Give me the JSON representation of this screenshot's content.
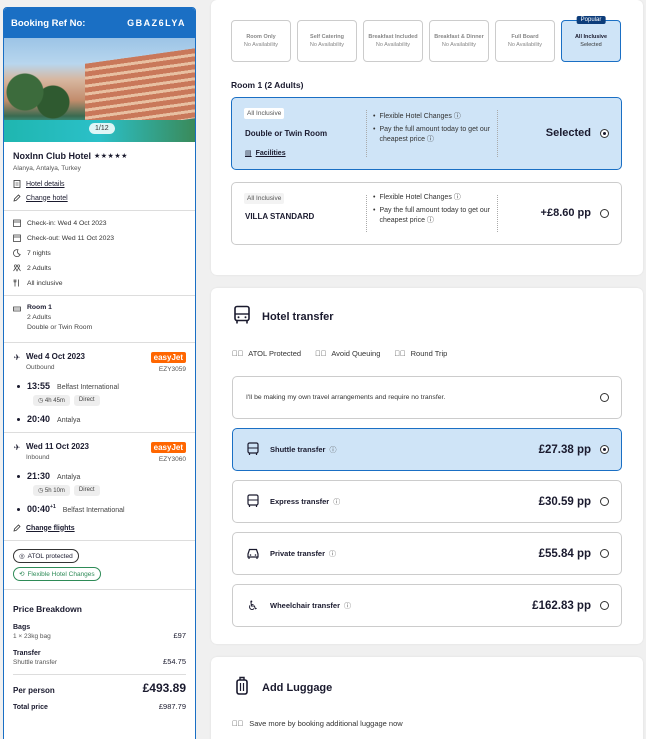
{
  "sidebar": {
    "ref_label": "Booking Ref No:",
    "ref_code": "GBAZ6LYA",
    "image_counter": "1/12",
    "hotel_name": "NoxInn Club Hotel",
    "stars": "★★★★★",
    "location": "Alanya, Antalya, Turkey",
    "hotel_details_link": "Hotel details",
    "change_hotel_link": "Change hotel",
    "check_in": "Check-in: Wed 4 Oct 2023",
    "check_out": "Check-out: Wed 11 Oct 2023",
    "nights": "7 nights",
    "adults": "2 Adults",
    "board": "All inclusive",
    "room": {
      "title": "Room 1",
      "adults": "2 Adults",
      "type": "Double or Twin Room"
    },
    "outbound": {
      "date": "Wed 4 Oct 2023",
      "direction": "Outbound",
      "airline": "easyJet",
      "flight_no": "EZY3059",
      "dep_time": "13:55",
      "dep_place": "Belfast International",
      "duration": "4h 45m",
      "stops": "Direct",
      "arr_time": "20:40",
      "arr_place": "Antalya"
    },
    "inbound": {
      "date": "Wed 11 Oct 2023",
      "direction": "Inbound",
      "airline": "easyJet",
      "flight_no": "EZY3060",
      "dep_time": "21:30",
      "dep_place": "Antalya",
      "duration": "5h 10m",
      "stops": "Direct",
      "arr_time": "00:40",
      "arr_day": "+1",
      "arr_place": "Belfast International"
    },
    "change_flights_link": "Change flights",
    "atol_pill": "ATOL protected",
    "flex_pill": "Flexible Hotel Changes",
    "price_breakdown": {
      "title": "Price Breakdown",
      "bags_label": "Bags",
      "bags_sub": "1 × 23kg bag",
      "bags_amt": "£97",
      "transfer_label": "Transfer",
      "transfer_sub": "Shuttle transfer",
      "transfer_amt": "£54.75",
      "per_person_label": "Per person",
      "per_person_amt": "£493.89",
      "total_label": "Total price",
      "total_amt": "£987.79"
    }
  },
  "board_tabs": [
    {
      "title": "Room Only",
      "sub": "No Availability"
    },
    {
      "title": "Self Catering",
      "sub": "No Availability"
    },
    {
      "title": "Breakfast Included",
      "sub": "No Availability"
    },
    {
      "title": "Breakfast & Dinner",
      "sub": "No Availability"
    },
    {
      "title": "Full Board",
      "sub": "No Availability"
    },
    {
      "title": "All Inclusive",
      "sub": "Selected",
      "badge": "Popular"
    }
  ],
  "room_section": {
    "title": "Room 1 (2 Adults)",
    "options": [
      {
        "badge": "All Inclusive",
        "name": "Double or Twin Room",
        "facilities": "Facilities",
        "bullet1": "Flexible Hotel Changes",
        "bullet2": "Pay the full amount today to get our cheapest price",
        "price": "Selected"
      },
      {
        "badge": "All Inclusive",
        "name": "VILLA STANDARD",
        "bullet1": "Flexible Hotel Changes",
        "bullet2": "Pay the full amount today to get our cheapest price",
        "price": "+£8.60 pp"
      }
    ]
  },
  "transfer": {
    "title": "Hotel transfer",
    "features": [
      "ATOL Protected",
      "Avoid Queuing",
      "Round Trip"
    ],
    "no_transfer": "I'll be making my own travel arrangements and require no transfer.",
    "options": [
      {
        "name": "Shuttle transfer",
        "price": "£27.38 pp",
        "icon": "bus-icon"
      },
      {
        "name": "Express transfer",
        "price": "£30.59 pp",
        "icon": "bus-icon"
      },
      {
        "name": "Private transfer",
        "price": "£55.84 pp",
        "icon": "car-icon"
      },
      {
        "name": "Wheelchair transfer",
        "price": "£162.83 pp",
        "icon": "wheelchair-icon"
      }
    ]
  },
  "luggage": {
    "title": "Add Luggage",
    "note": "Save more by booking additional luggage now"
  },
  "colors": {
    "brand": "#1a6fc4",
    "selected_bg": "#cfe4f7",
    "easyjet": "#ff6600",
    "popular": "#0c3c7a"
  }
}
